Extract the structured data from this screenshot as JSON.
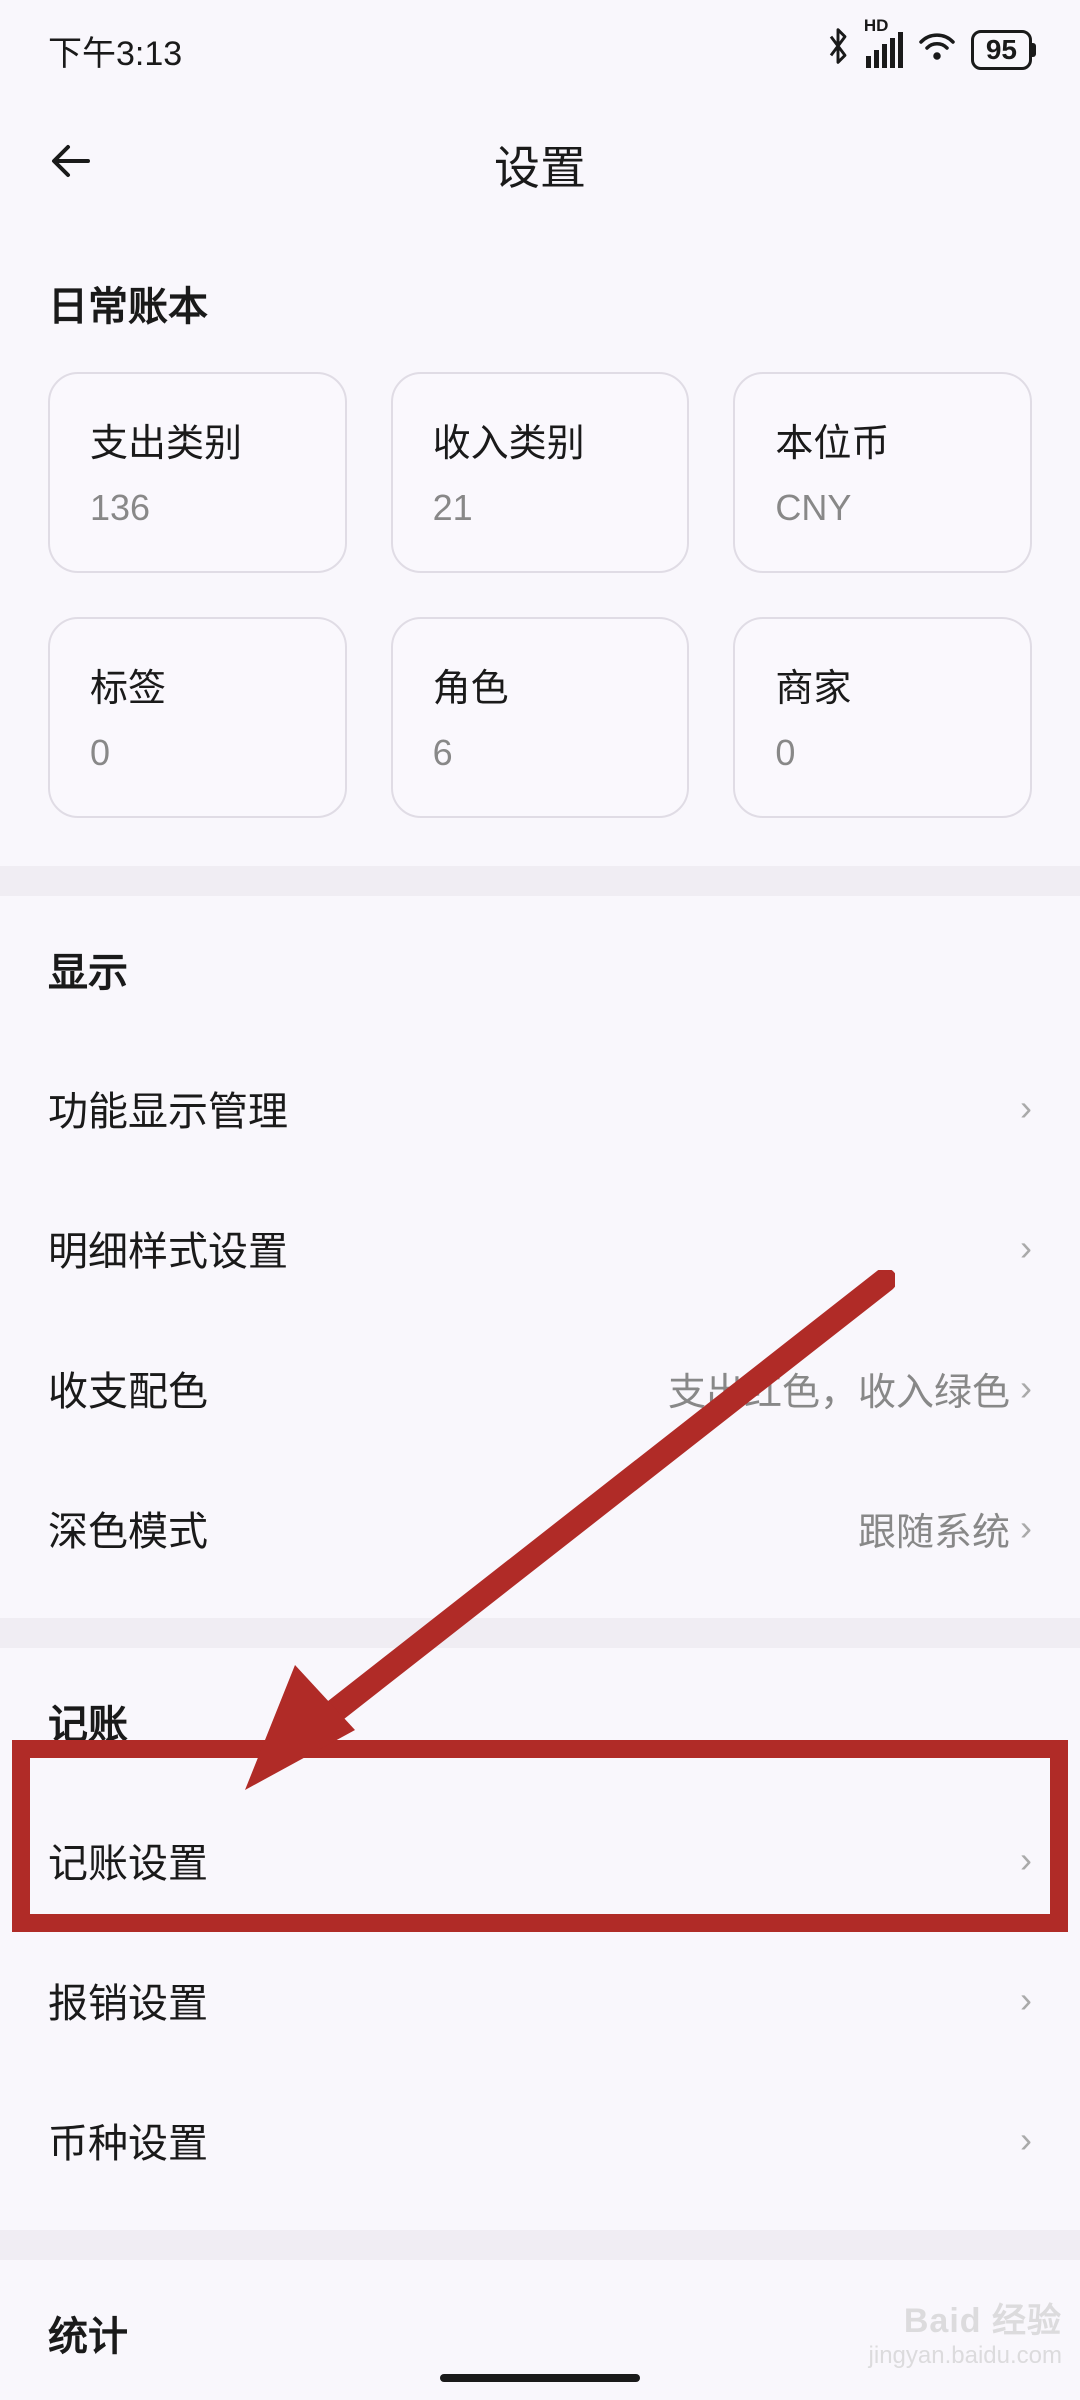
{
  "status": {
    "time": "下午3:13",
    "hd": "HD",
    "battery": "95"
  },
  "header": {
    "title": "设置"
  },
  "ledger": {
    "title": "日常账本",
    "cards": [
      {
        "label": "支出类别",
        "value": "136"
      },
      {
        "label": "收入类别",
        "value": "21"
      },
      {
        "label": "本位币",
        "value": "CNY"
      },
      {
        "label": "标签",
        "value": "0"
      },
      {
        "label": "角色",
        "value": "6"
      },
      {
        "label": "商家",
        "value": "0"
      }
    ]
  },
  "display": {
    "title": "显示",
    "items": [
      {
        "label": "功能显示管理",
        "value": ""
      },
      {
        "label": "明细样式设置",
        "value": ""
      },
      {
        "label": "收支配色",
        "value": "支出红色，收入绿色"
      },
      {
        "label": "深色模式",
        "value": "跟随系统"
      }
    ]
  },
  "accounting": {
    "title": "记账",
    "items": [
      {
        "label": "记账设置",
        "value": ""
      },
      {
        "label": "报销设置",
        "value": ""
      },
      {
        "label": "币种设置",
        "value": ""
      }
    ]
  },
  "statistics": {
    "title": "统计"
  },
  "watermark": {
    "main": "Baid 经验",
    "sub": "jingyan.baidu.com"
  },
  "annotation": {
    "highlight_color": "#b02b27"
  }
}
